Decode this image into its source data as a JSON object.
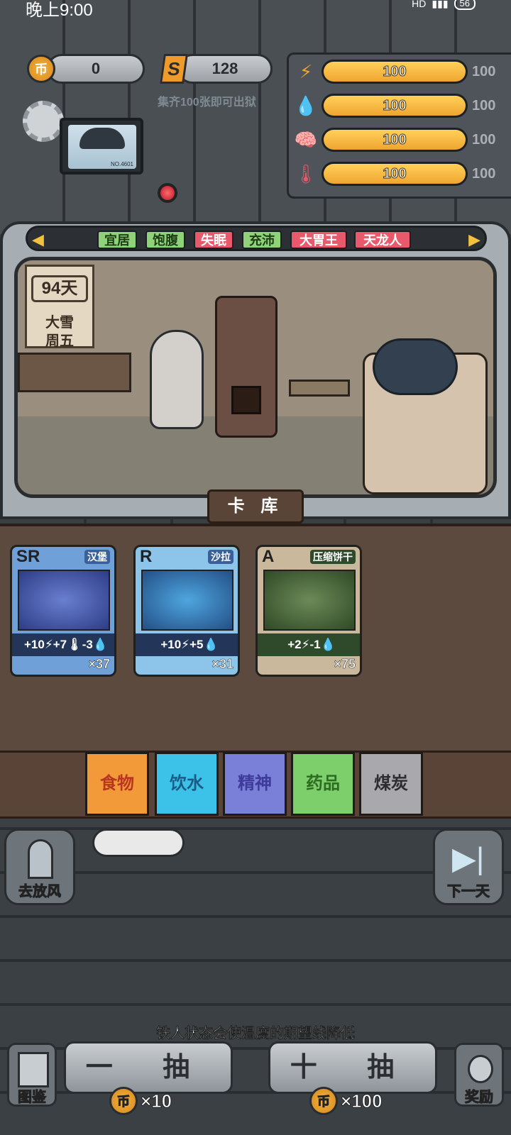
{
  "status_bar": {
    "time": "晚上9:00",
    "right": "HD",
    "battery": "56"
  },
  "currency": {
    "coin_symbol": "币",
    "coins": "0",
    "s_symbol": "S",
    "shards": "128",
    "hint": "集齐100张即可出狱"
  },
  "stats": [
    {
      "icon": "energy-bolt-icon",
      "glyph": "⚡",
      "value": "100",
      "max": "100",
      "level": 1.0,
      "color": "#f0a530"
    },
    {
      "icon": "water-drop-icon",
      "glyph": "💧",
      "value": "100",
      "max": "100",
      "level": 1.0,
      "color": "#3da6e8"
    },
    {
      "icon": "brain-icon",
      "glyph": "🧠",
      "value": "100",
      "max": "100",
      "level": 1.0,
      "color": "#7a6fd8"
    },
    {
      "icon": "thermometer-icon",
      "glyph": "🌡",
      "value": "100",
      "max": "100",
      "level": 1.0,
      "color": "#e8596b"
    }
  ],
  "monitor": {
    "id": "NO.4601"
  },
  "tags": [
    {
      "label": "宜居",
      "kind": "green"
    },
    {
      "label": "饱腹",
      "kind": "green"
    },
    {
      "label": "失眠",
      "kind": "red"
    },
    {
      "label": "充沛",
      "kind": "green"
    },
    {
      "label": "大胃王",
      "kind": "red"
    },
    {
      "label": "天龙人",
      "kind": "red"
    }
  ],
  "calendar": {
    "days": "94天",
    "weather": "大雪",
    "weekday": "周五"
  },
  "library_label": "卡 库",
  "cards": [
    {
      "rarity": "SR",
      "name": "汉堡",
      "effect": "+10⚡+7🌡-3💧",
      "count": "×37",
      "color": "#6fa0d8"
    },
    {
      "rarity": "R",
      "name": "沙拉",
      "effect": "+10⚡+5💧",
      "count": "×31",
      "color": "#8cc4ea"
    },
    {
      "rarity": "A",
      "name": "压缩饼干",
      "effect": "+2⚡-1💧",
      "count": "×75",
      "color": "#c9b89c"
    }
  ],
  "categories": [
    {
      "label": "食物",
      "color": "#f29a3a",
      "text": "#b8361f"
    },
    {
      "label": "饮水",
      "color": "#3cc2e8",
      "text": "#1a5c86"
    },
    {
      "label": "精神",
      "color": "#7a7fd8",
      "text": "#3e3a9a"
    },
    {
      "label": "药品",
      "color": "#7ccf6a",
      "text": "#2d6a22"
    },
    {
      "label": "煤炭",
      "color": "#a9a9ad",
      "text": "#2d2d30"
    }
  ],
  "go_out_label": "去放风",
  "next_day_label": "下一天",
  "tip": "铁人状态会使温度的期望线降低",
  "draw_one": {
    "label": "一 抽",
    "coin": "币",
    "cost": "×10"
  },
  "draw_ten": {
    "label": "十 抽",
    "coin": "币",
    "cost": "×100"
  },
  "codex_label": "图鉴",
  "reward_label": "奖励"
}
